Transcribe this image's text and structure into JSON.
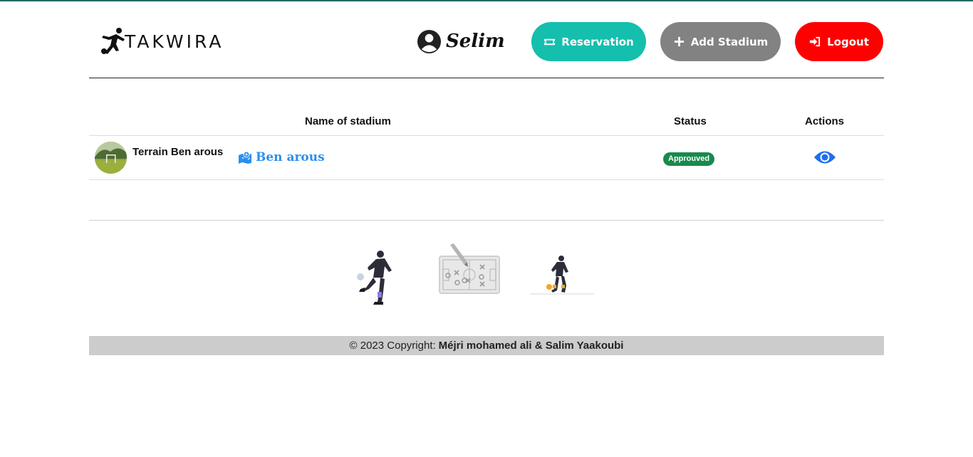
{
  "brand": {
    "logo_text": "TAKWIRA"
  },
  "user": {
    "name": "Selim"
  },
  "nav": {
    "reservation_label": "Reservation",
    "add_stadium_label": "Add Stadium",
    "logout_label": "Logout"
  },
  "colors": {
    "reservation": "#14bfae",
    "add_stadium": "#828282",
    "logout": "#ff0000",
    "approved_badge": "#178a4c",
    "location_link": "#2a8ff0",
    "footer_bg": "#cccccc"
  },
  "table": {
    "headers": {
      "name": "Name of stadium",
      "status": "Status",
      "actions": "Actions"
    },
    "rows": [
      {
        "name": "Terrain Ben arous",
        "location": "Ben arous",
        "status": "Approuved",
        "action_icon": "eye-icon"
      }
    ]
  },
  "footer": {
    "prefix": "© 2023 Copyright:",
    "authors": "Méjri mohamed ali & Salim Yaakoubi"
  }
}
